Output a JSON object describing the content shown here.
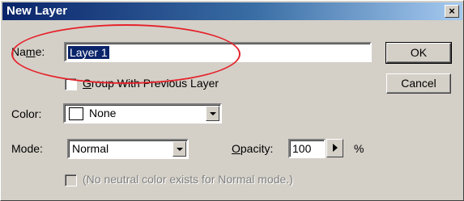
{
  "dialog": {
    "title": "New Layer",
    "close_glyph": "×"
  },
  "name": {
    "label_pre": "Na",
    "label_accel": "m",
    "label_post": "e:",
    "value": "Layer 1"
  },
  "group": {
    "accel": "G",
    "label_rest": "roup With Previous Layer",
    "checked": false
  },
  "color": {
    "label": "Color:",
    "value": "None",
    "swatch": "#ffffff"
  },
  "mode": {
    "label": "Mode:",
    "value": "Normal"
  },
  "opacity": {
    "label_accel": "O",
    "label_rest": "pacity:",
    "value": "100",
    "unit": "%"
  },
  "neutral": {
    "label": "(No neutral color exists for Normal mode.)",
    "enabled": false
  },
  "buttons": {
    "ok": "OK",
    "cancel": "Cancel"
  },
  "colors": {
    "titlebar_start": "#0a246a",
    "selection": "#0a246a",
    "annotation": "#e5232b"
  }
}
